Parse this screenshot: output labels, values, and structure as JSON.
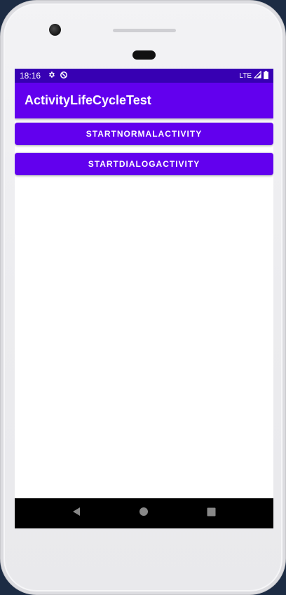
{
  "status_bar": {
    "time": "18:16",
    "network": "LTE",
    "icons": [
      "gear-icon",
      "data-saver-icon",
      "signal-icon",
      "battery-icon"
    ]
  },
  "app_bar": {
    "title": "ActivityLifeCycleTest"
  },
  "buttons": [
    {
      "label": "STARTNORMALACTIVITY"
    },
    {
      "label": "STARTDIALOGACTIVITY"
    }
  ],
  "nav_bar": {
    "icons": [
      "back-icon",
      "home-icon",
      "recents-icon"
    ]
  },
  "colors": {
    "primary": "#6200ee",
    "primary_dark": "#3700b3",
    "nav_bar": "#000000"
  }
}
